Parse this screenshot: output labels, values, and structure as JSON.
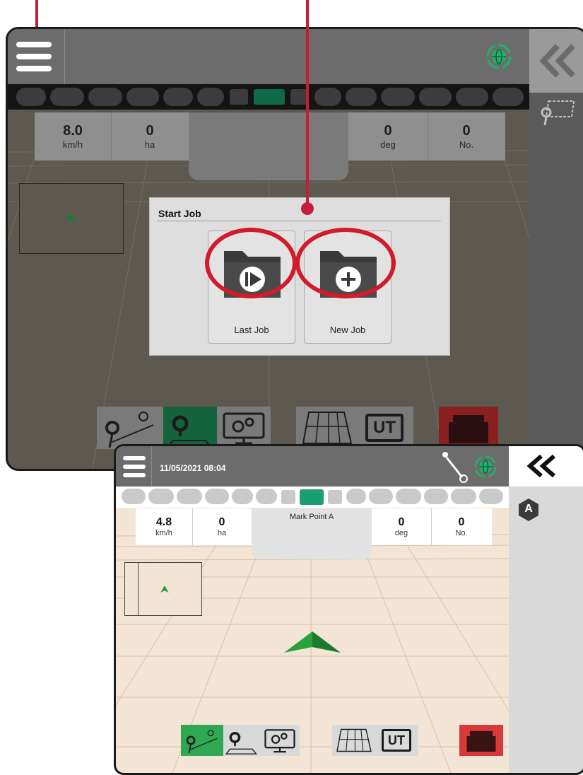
{
  "screen1": {
    "stats": [
      {
        "value": "8.0",
        "unit": "km/h"
      },
      {
        "value": "0",
        "unit": "ha"
      },
      {
        "value": "0",
        "unit": "deg"
      },
      {
        "value": "0",
        "unit": "No."
      }
    ],
    "start_job": {
      "title": "Start Job",
      "last_job_label": "Last Job",
      "new_job_label": "New Job"
    }
  },
  "screen2": {
    "datetime": "11/05/2021 08:04",
    "stats": [
      {
        "value": "4.8",
        "unit": "km/h"
      },
      {
        "value": "0",
        "unit": "ha"
      },
      {
        "value": "0",
        "unit": "deg"
      },
      {
        "value": "0",
        "unit": "No."
      }
    ],
    "center_label": "Mark Point A",
    "side_badge": "A",
    "ut_label": "UT"
  },
  "colors": {
    "accent_green": "#1a9e5c",
    "callout_red": "#c41e3a",
    "alert_red": "#d83a3a"
  }
}
